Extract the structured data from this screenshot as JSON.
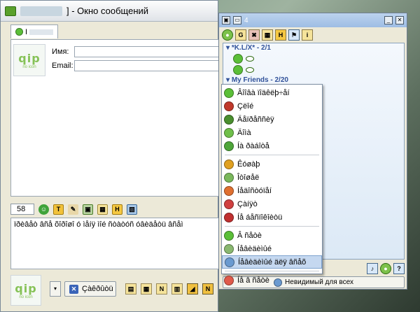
{
  "chat_window": {
    "title": "] - Окно сообщений",
    "tab_label": "I",
    "logo_text": "qip",
    "logo_subtext": "no icon",
    "name_label": "Имя:",
    "email_label": "Email:",
    "counter_value": "58",
    "message_text": "ïðèâåò âñå õîðîøî ó ìåíÿ ìîé ñòàòóñ óâèäåòü âñåì",
    "close_button_label": "Çàêðûòü",
    "drop_label": "▾",
    "toolbar_icons": [
      "emoticon-icon",
      "t-icon",
      "paint-icon",
      "save-icon",
      "box-icon",
      "h-icon",
      "image-icon"
    ],
    "toolbar_letters": [
      "☺",
      "T",
      "✎",
      "▣",
      "▦",
      "H",
      "▧"
    ],
    "bottom_tool_letters": [
      "▤",
      "▦",
      "N",
      "▥",
      "◢",
      "N"
    ]
  },
  "contact_list": {
    "title": "4",
    "toolbar_letters": [
      "●",
      "G",
      "✖",
      "▦",
      "H",
      "⚑",
      "i"
    ],
    "groups": [
      {
        "name": "*K.L/X* - 2/1",
        "contacts": 2
      },
      {
        "name": "My Friends - 2/20",
        "contacts": 0
      }
    ],
    "status_button_label": "Невидимый для всех"
  },
  "status_menu": {
    "items": [
      {
        "label": "Âîîâà ïîäêëþ÷åí",
        "icon_color": "#5bbf38"
      },
      {
        "label": "Çëîé",
        "icon_color": "#c0392b"
      },
      {
        "label": "Äåïðåññèÿ",
        "icon_color": "#4a8f2e"
      },
      {
        "label": "Äîìà",
        "icon_color": "#6fbf4a"
      },
      {
        "label": "Íà ðàáîòå",
        "icon_color": "#4ea63a"
      }
    ],
    "items2": [
      {
        "label": "Êóøàþ",
        "icon_color": "#e0a020"
      },
      {
        "label": "Îòîøåë",
        "icon_color": "#7ab85c"
      },
      {
        "label": "Íåäîñòóïåí",
        "icon_color": "#e07030"
      },
      {
        "label": "Çàíÿò",
        "icon_color": "#d04040"
      },
      {
        "label": "Íå áåñïîêîèòü",
        "icon_color": "#c03030"
      }
    ],
    "items3": [
      {
        "label": "Â ñåòè",
        "icon_color": "#5bbf38"
      },
      {
        "label": "Íåâèäèìûé",
        "icon_color": "#8ab870"
      },
      {
        "label": "Íåâèäèìûé äëÿ âñåõ",
        "icon_color": "#6a9ad0"
      }
    ],
    "offline": {
      "label": "Íå â ñåòè",
      "icon_color": "#e05a4a"
    }
  }
}
